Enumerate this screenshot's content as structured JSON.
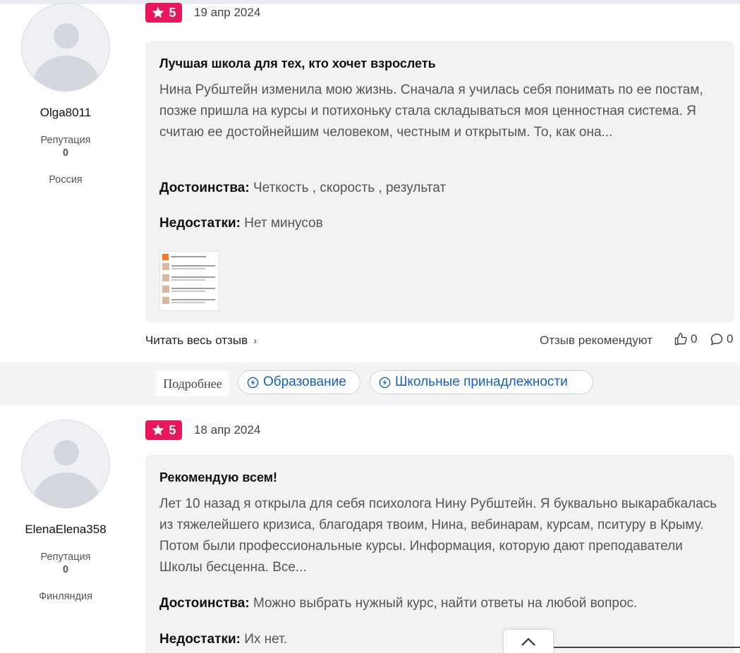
{
  "reviews": [
    {
      "author": {
        "username": "Olga8011",
        "reputation_label": "Репутация",
        "reputation_value": "0",
        "country": "Россия"
      },
      "rating": "5",
      "date": "19 апр 2024",
      "title": "Лучшая школа для тех, кто хочет взрослеть",
      "text": "Нина Рубштейн изменила мою жизнь. Сначала я училась себя понимать по ее постам, позже пришла на курсы и потихоньку стала складываться моя ценностная система. Я считаю ее достойнейшим человеком, честным и открытым. То, как она...",
      "pros_label": "Достоинства:",
      "pros": "Четкость , скорость , результат",
      "cons_label": "Недостатки:",
      "cons": "Нет минусов",
      "read_more": "Читать весь отзыв",
      "recommend_label": "Отзыв рекомендуют",
      "likes": "0",
      "comments": "0"
    },
    {
      "author": {
        "username": "ElenaElena358",
        "reputation_label": "Репутация",
        "reputation_value": "0",
        "country": "Финляндия"
      },
      "rating": "5",
      "date": "18 апр 2024",
      "title": "Рекомендую всем!",
      "text": "Лет 10 назад я открыла для себя психолога Нину Рубштейн. Я буквально выкарабкалась из тяжелейшего кризиса, благодаря твоим, Нина, вебинарам, курсам, пситуру в Крыму. Потом были профессиональные курсы. Информация, которую дают преподаватели Школы бесценна. Все...",
      "pros_label": "Достоинства:",
      "pros": "Можно выбрать нужный курс, найти ответы на любой вопрос.",
      "cons_label": "Недостатки:",
      "cons": "Их нет."
    }
  ],
  "tags": {
    "more_label": "Подробнее",
    "items": [
      "Образование",
      "Школьные принадлежности"
    ]
  },
  "colors": {
    "rating_badge": "#e8175d",
    "tag_link": "#1561c9",
    "card_bg": "#f2f2f2"
  },
  "icons": {
    "rating": "star-icon",
    "tag": "lightning-circle-icon",
    "like": "thumbs-up-icon",
    "comment": "comment-icon",
    "scroll": "chevron-up-icon"
  }
}
